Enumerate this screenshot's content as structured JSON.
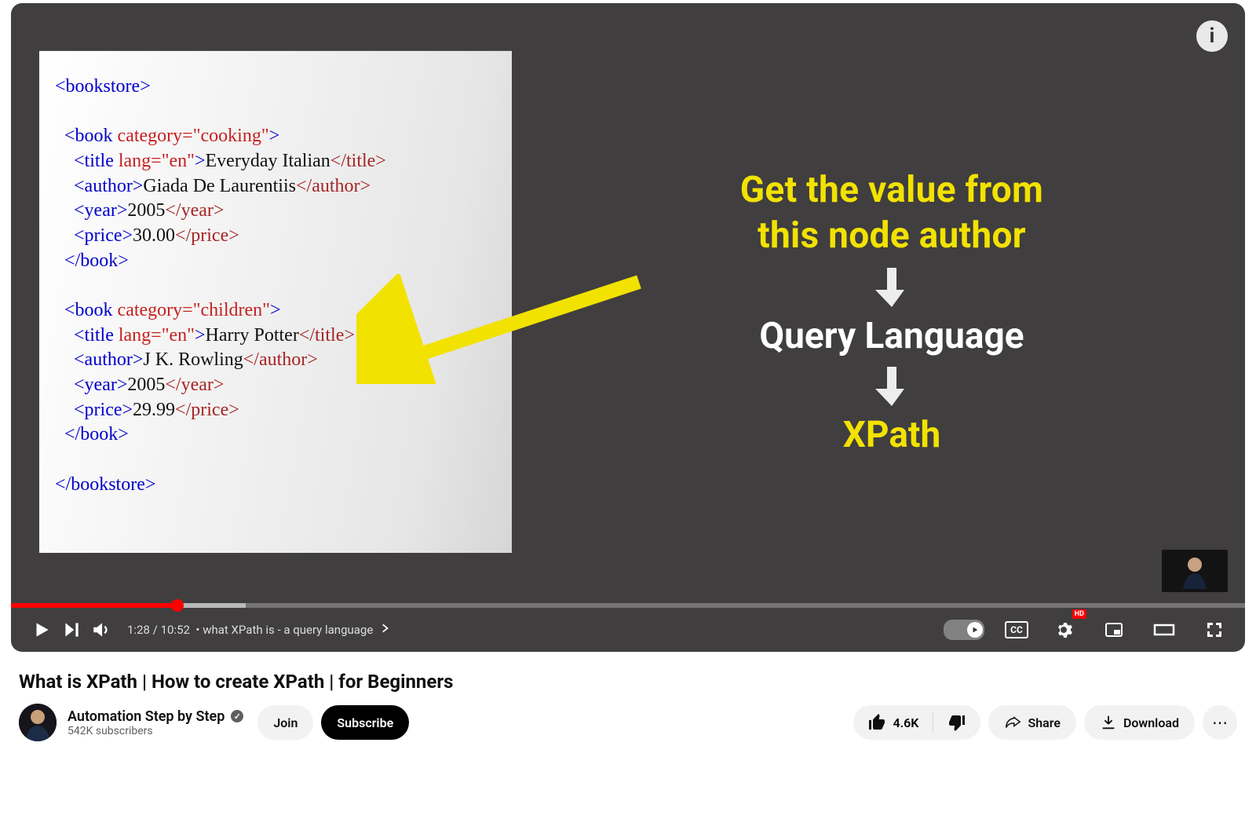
{
  "player": {
    "info_icon_text": "i",
    "current_time": "1:28",
    "total_time": "10:52",
    "chapter_sep": "•",
    "chapter_label": "what XPath is - a query language",
    "cc_label": "CC",
    "quality_badge": "HD"
  },
  "slide": {
    "code_lines": [
      [
        {
          "cls": "tag-b",
          "txt": "<bookstore>"
        }
      ],
      [],
      [
        {
          "cls": "tag-b",
          "txt": "  <book "
        },
        {
          "cls": "attr-r",
          "txt": "category=\"cooking\""
        },
        {
          "cls": "tag-b",
          "txt": ">"
        }
      ],
      [
        {
          "cls": "tag-b",
          "txt": "    <title "
        },
        {
          "cls": "attr-r",
          "txt": "lang=\"en\""
        },
        {
          "cls": "tag-b",
          "txt": ">"
        },
        {
          "cls": "txt-bk",
          "txt": "Everyday Italian"
        },
        {
          "cls": "close-r",
          "txt": "</title>"
        }
      ],
      [
        {
          "cls": "tag-b",
          "txt": "    <author>"
        },
        {
          "cls": "txt-bk",
          "txt": "Giada De Laurentiis"
        },
        {
          "cls": "close-r",
          "txt": "</author>"
        }
      ],
      [
        {
          "cls": "tag-b",
          "txt": "    <year>"
        },
        {
          "cls": "txt-bk",
          "txt": "2005"
        },
        {
          "cls": "close-r",
          "txt": "</year>"
        }
      ],
      [
        {
          "cls": "tag-b",
          "txt": "    <price>"
        },
        {
          "cls": "txt-bk",
          "txt": "30.00"
        },
        {
          "cls": "close-r",
          "txt": "</price>"
        }
      ],
      [
        {
          "cls": "tag-b",
          "txt": "  </book>"
        }
      ],
      [],
      [
        {
          "cls": "tag-b",
          "txt": "  <book "
        },
        {
          "cls": "attr-r",
          "txt": "category=\"children\""
        },
        {
          "cls": "tag-b",
          "txt": ">"
        }
      ],
      [
        {
          "cls": "tag-b",
          "txt": "    <title "
        },
        {
          "cls": "attr-r",
          "txt": "lang=\"en\""
        },
        {
          "cls": "tag-b",
          "txt": ">"
        },
        {
          "cls": "txt-bk",
          "txt": "Harry Potter"
        },
        {
          "cls": "close-r",
          "txt": "</title>"
        }
      ],
      [
        {
          "cls": "tag-b",
          "txt": "    <author>"
        },
        {
          "cls": "txt-bk",
          "txt": "J K. Rowling"
        },
        {
          "cls": "close-r",
          "txt": "</author>"
        }
      ],
      [
        {
          "cls": "tag-b",
          "txt": "    <year>"
        },
        {
          "cls": "txt-bk",
          "txt": "2005"
        },
        {
          "cls": "close-r",
          "txt": "</year>"
        }
      ],
      [
        {
          "cls": "tag-b",
          "txt": "    <price>"
        },
        {
          "cls": "txt-bk",
          "txt": "29.99"
        },
        {
          "cls": "close-r",
          "txt": "</price>"
        }
      ],
      [
        {
          "cls": "tag-b",
          "txt": "  </book>"
        }
      ],
      [],
      [
        {
          "cls": "tag-b",
          "txt": "</bookstore>"
        }
      ]
    ],
    "headline1": "Get the value from",
    "headline2": "this node author",
    "mid_label": "Query Language",
    "final_label": "XPath"
  },
  "video_title": "What is XPath | How to create XPath | for Beginners",
  "channel": {
    "name": "Automation Step by Step",
    "subscribers": "542K subscribers"
  },
  "buttons": {
    "join": "Join",
    "subscribe": "Subscribe",
    "likes": "4.6K",
    "share": "Share",
    "download": "Download"
  }
}
